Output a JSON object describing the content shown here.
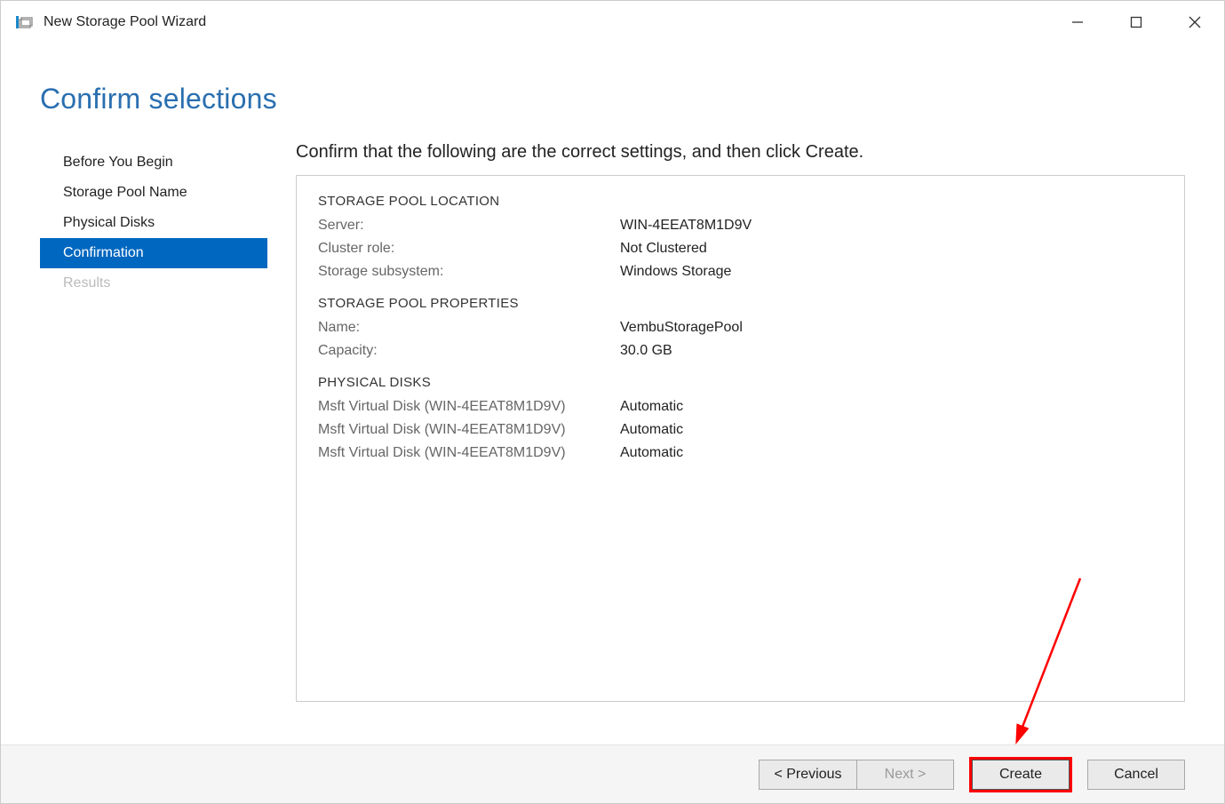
{
  "window": {
    "title": "New Storage Pool Wizard"
  },
  "heading": "Confirm selections",
  "steps": [
    {
      "label": "Before You Begin",
      "state": "normal"
    },
    {
      "label": "Storage Pool Name",
      "state": "normal"
    },
    {
      "label": "Physical Disks",
      "state": "normal"
    },
    {
      "label": "Confirmation",
      "state": "active"
    },
    {
      "label": "Results",
      "state": "disabled"
    }
  ],
  "instruction": "Confirm that the following are the correct settings, and then click Create.",
  "sections": {
    "location": {
      "header": "STORAGE POOL LOCATION",
      "server_label": "Server:",
      "server_value": "WIN-4EEAT8M1D9V",
      "cluster_label": "Cluster role:",
      "cluster_value": "Not Clustered",
      "subsystem_label": "Storage subsystem:",
      "subsystem_value": "Windows Storage"
    },
    "properties": {
      "header": "STORAGE POOL PROPERTIES",
      "name_label": "Name:",
      "name_value": "VembuStoragePool",
      "capacity_label": "Capacity:",
      "capacity_value": "30.0 GB"
    },
    "disks": {
      "header": "PHYSICAL DISKS",
      "items": [
        {
          "name": "Msft Virtual Disk (WIN-4EEAT8M1D9V)",
          "alloc": "Automatic"
        },
        {
          "name": "Msft Virtual Disk (WIN-4EEAT8M1D9V)",
          "alloc": "Automatic"
        },
        {
          "name": "Msft Virtual Disk (WIN-4EEAT8M1D9V)",
          "alloc": "Automatic"
        }
      ]
    }
  },
  "buttons": {
    "previous": "< Previous",
    "next": "Next >",
    "create": "Create",
    "cancel": "Cancel"
  }
}
